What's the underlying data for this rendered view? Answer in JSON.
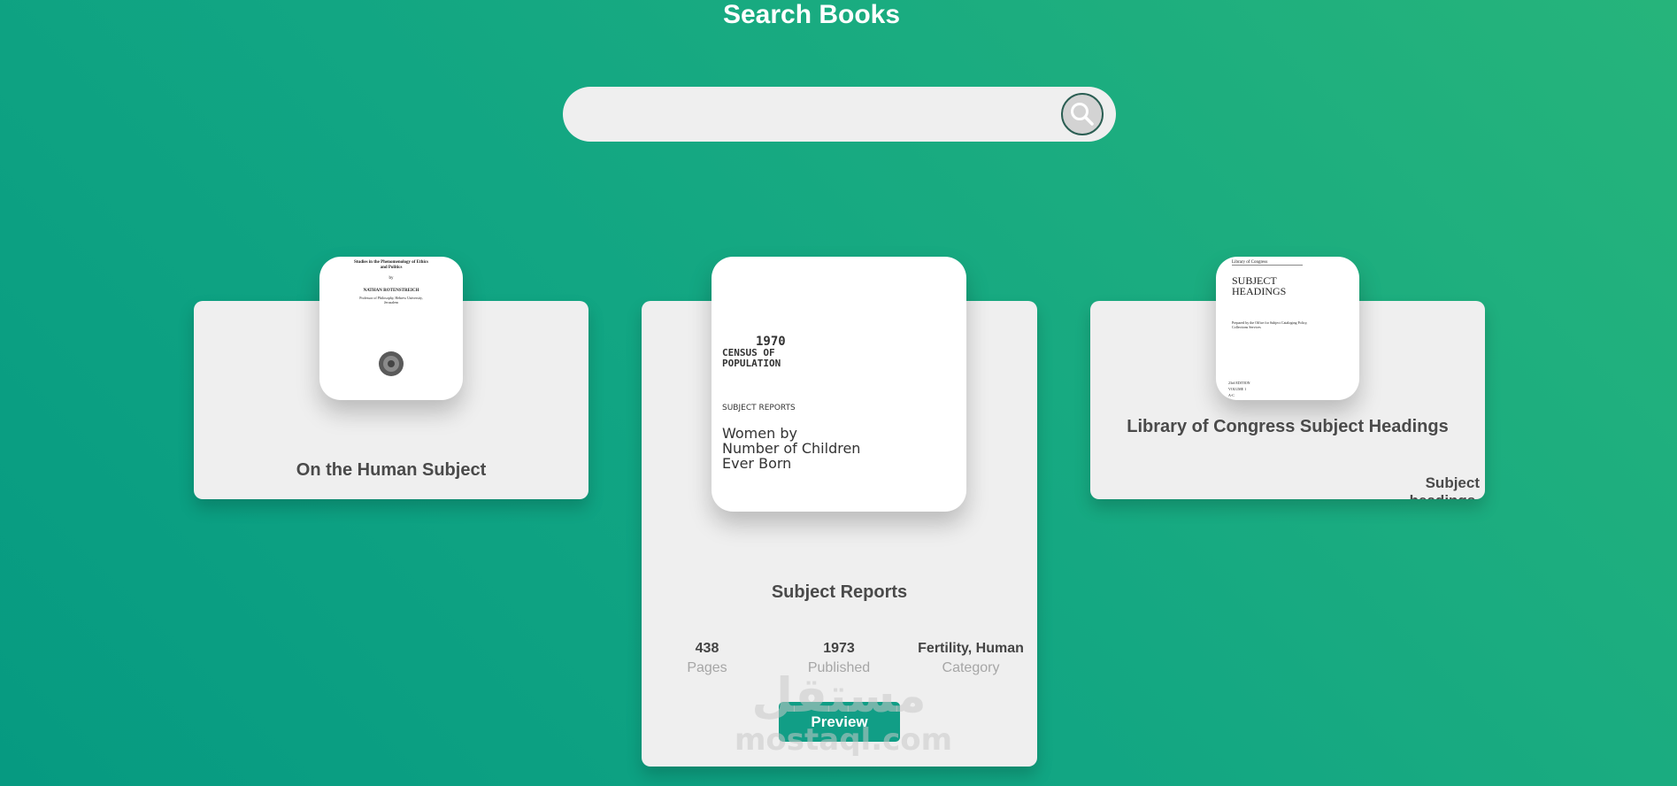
{
  "header": {
    "title": "Search Books"
  },
  "search": {
    "value": "",
    "placeholder": "",
    "button_icon": "search-icon"
  },
  "books": [
    {
      "title": "On the Human Subject",
      "cover": {
        "line1": "Studies in the Phenomenology of Ethics and Politics",
        "line2": "by",
        "author": "NATHAN ROTENSTREICH",
        "affiliation": "Professor of Philosophy, Hebrew University, Jerusalem"
      }
    },
    {
      "title": "Subject Reports",
      "cover": {
        "year": "1970",
        "census_line1": "CENSUS OF",
        "census_line2": "POPULATION",
        "series": "SUBJECT REPORTS",
        "heading_line1": "Women by",
        "heading_line2": "Number of Children",
        "heading_line3": "Ever Born"
      },
      "stats": [
        {
          "value": "438",
          "label": "Pages"
        },
        {
          "value": "1973",
          "label": "Published"
        },
        {
          "value": "Fertility, Human",
          "label": "Category"
        }
      ],
      "preview_label": "Preview"
    },
    {
      "title": "Library of Congress Subject Headings",
      "cover": {
        "publisher": "Library of Congress",
        "heading_line1": "SUBJECT",
        "heading_line2": "HEADINGS",
        "note": "Prepared by the Office for Subject Cataloging Policy, Collections Services",
        "edition": "23rd EDITION",
        "volume": "VOLUME 1",
        "letters": "A-C"
      },
      "description": "Subject headings,"
    }
  ],
  "watermark": {
    "arabic": "مستقل",
    "latin": "mostaql.com"
  }
}
